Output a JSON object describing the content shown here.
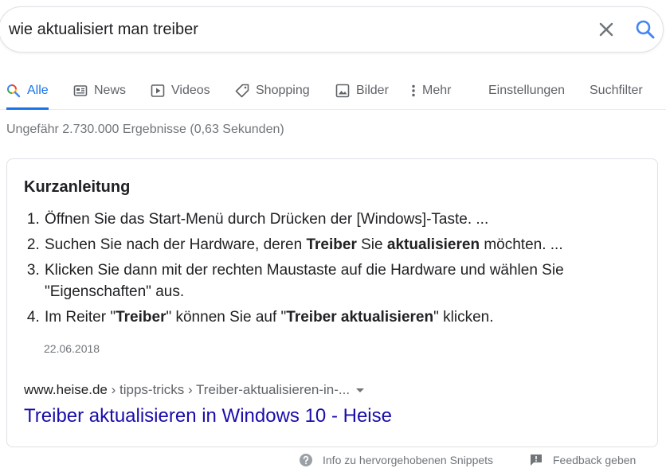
{
  "search": {
    "query": "wie aktualisiert man treiber"
  },
  "tabs": [
    {
      "label": "Alle"
    },
    {
      "label": "News"
    },
    {
      "label": "Videos"
    },
    {
      "label": "Shopping"
    },
    {
      "label": "Bilder"
    },
    {
      "label": "Mehr"
    },
    {
      "label": "Einstellungen"
    },
    {
      "label": "Suchfilter"
    }
  ],
  "result_stats": "Ungefähr 2.730.000 Ergebnisse (0,63 Sekunden)",
  "snippet": {
    "heading": "Kurzanleitung",
    "steps": [
      {
        "parts": [
          "Öffnen Sie das Start-Menü durch Drücken der [Windows]-Taste. ..."
        ]
      },
      {
        "parts": [
          "Suchen Sie nach der Hardware, deren ",
          "Treiber",
          " Sie ",
          "aktualisieren",
          " möchten. ..."
        ]
      },
      {
        "parts": [
          "Klicken Sie dann mit der rechten Maustaste auf die Hardware und wählen Sie \"Eigenschaften\" aus."
        ]
      },
      {
        "parts": [
          "Im Reiter \"",
          "Treiber",
          "\" können Sie auf \"",
          "Treiber aktualisieren",
          "\" klicken."
        ]
      }
    ],
    "date": "22.06.2018",
    "cite_domain": "www.heise.de",
    "cite_path": " › tipps-tricks › Treiber-aktualisieren-in-...",
    "link_title": "Treiber aktualisieren in Windows 10 - Heise"
  },
  "footer": {
    "info_label": "Info zu hervorgehobenen Snippets",
    "feedback_label": "Feedback geben"
  },
  "colors": {
    "accent": "#1a73e8",
    "link": "#1a0dab",
    "muted": "#70757a"
  }
}
